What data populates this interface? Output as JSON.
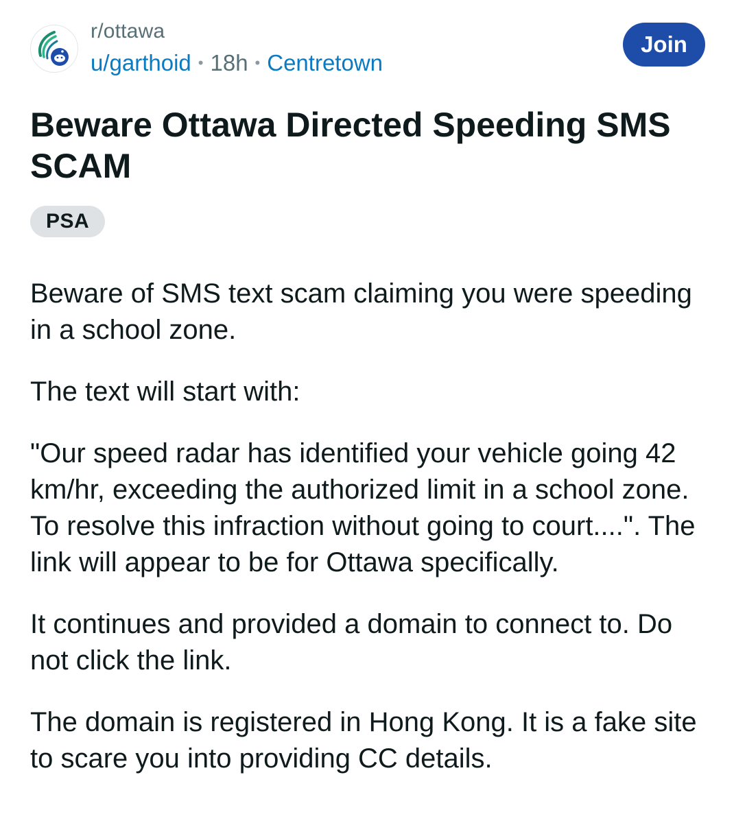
{
  "post": {
    "subreddit": "r/ottawa",
    "author": "u/garthoid",
    "separator": "•",
    "age": "18h",
    "location": "Centretown",
    "join_label": "Join",
    "title": "Beware Ottawa Directed Speeding SMS SCAM",
    "flair": "PSA",
    "paragraphs": [
      "Beware of SMS text scam claiming you were speeding in a school zone.",
      "The text will start with:",
      "\"Our speed radar has identified your vehicle going 42 km/hr, exceeding the authorized limit in a school zone. To resolve this infraction without going to court....\". The link will appear to be for Ottawa specifically.",
      "It continues and provided a domain to connect to. Do not click the link.",
      "The domain is registered in Hong Kong. It is a fake site to scare you into providing CC details."
    ]
  },
  "icons": {
    "community_avatar": "subreddit-avatar-icon"
  },
  "colors": {
    "join_button": "#1d4ca9",
    "link": "#0a7ac2",
    "meta_text": "#576f76",
    "flair_bg": "#dfe2e4"
  }
}
